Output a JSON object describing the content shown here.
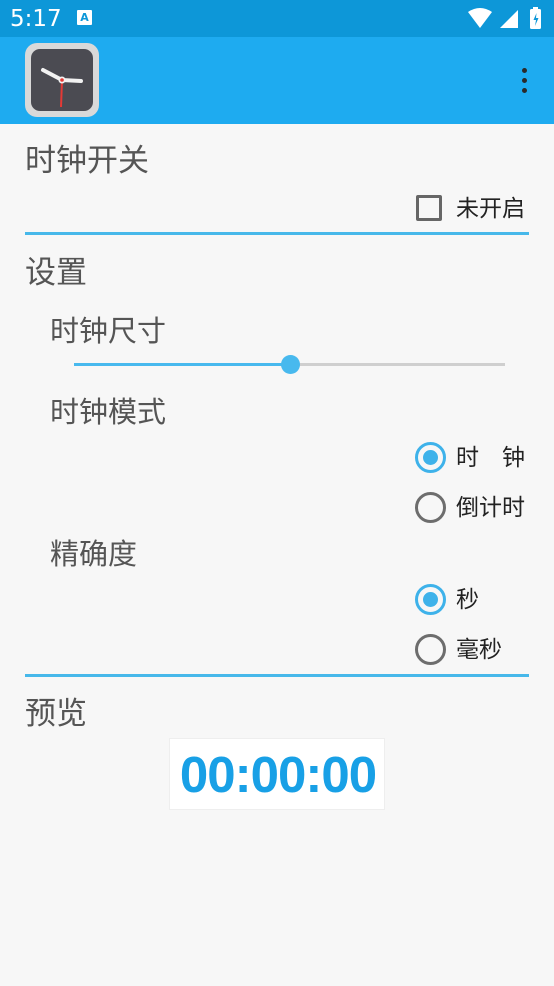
{
  "status_bar": {
    "time": "5:17",
    "notification_icon": "A",
    "icons": [
      "wifi-icon",
      "signal-icon",
      "battery-icon"
    ]
  },
  "app_bar": {
    "app_icon": "clock-app-icon",
    "overflow_menu_icon": "more-vert-icon"
  },
  "clock_switch": {
    "title": "时钟开关",
    "checkbox_label": "未开启",
    "checked": false
  },
  "settings": {
    "title": "设置",
    "size": {
      "title": "时钟尺寸",
      "value_fraction": 0.5
    },
    "mode": {
      "title": "时钟模式",
      "options": [
        {
          "label": "时　钟",
          "checked": true
        },
        {
          "label": "倒计时",
          "checked": false
        }
      ]
    },
    "precision": {
      "title": "精确度",
      "options": [
        {
          "label": "秒",
          "checked": true
        },
        {
          "label": "毫秒",
          "checked": false
        }
      ]
    }
  },
  "preview": {
    "title": "预览",
    "time_display": "00:00:00"
  },
  "colors": {
    "status_bar": "#0d97d8",
    "app_bar": "#1eabf0",
    "accent": "#3eb2ea",
    "preview_text": "#18a0e6"
  }
}
